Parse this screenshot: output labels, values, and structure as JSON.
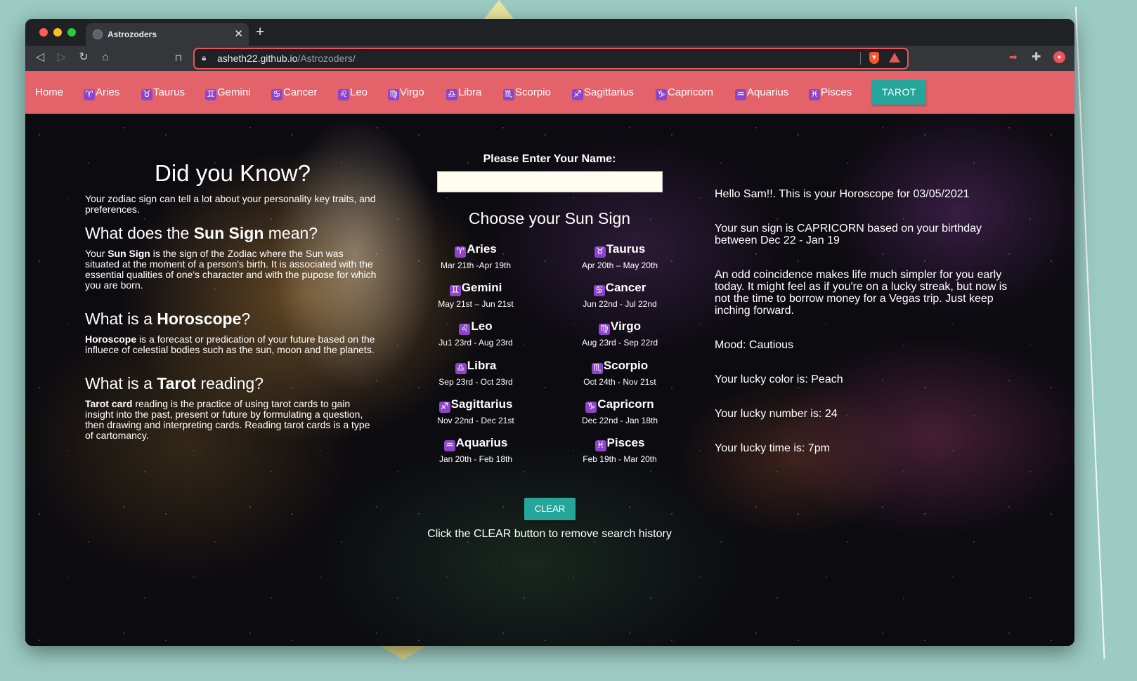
{
  "browser": {
    "tab_title": "Astrozoders",
    "url_host": "asheth22.github.io",
    "url_path": "/Astrozoders/"
  },
  "nav": {
    "home": "Home",
    "items": [
      {
        "symbol": "♈",
        "label": "Aries"
      },
      {
        "symbol": "♉",
        "label": "Taurus"
      },
      {
        "symbol": "♊",
        "label": "Gemini"
      },
      {
        "symbol": "♋",
        "label": "Cancer"
      },
      {
        "symbol": "♌",
        "label": "Leo"
      },
      {
        "symbol": "♍",
        "label": "Virgo"
      },
      {
        "symbol": "♎",
        "label": "Libra"
      },
      {
        "symbol": "♏",
        "label": "Scorpio"
      },
      {
        "symbol": "♐",
        "label": "Sagittarius"
      },
      {
        "symbol": "♑",
        "label": "Capricorn"
      },
      {
        "symbol": "♒",
        "label": "Aquarius"
      },
      {
        "symbol": "♓",
        "label": "Pisces"
      }
    ],
    "tarot": "TAROT"
  },
  "left": {
    "title": "Did you Know?",
    "intro": "Your zodiac sign can tell a lot about your personality key traits, and preferences.",
    "sun_q": {
      "pre": "What does the ",
      "bold": "Sun Sign",
      "post": " mean?"
    },
    "sun_p": {
      "pre": "Your ",
      "bold": "Sun Sign",
      "post": " is the sign of the Zodiac where the Sun was situated at the moment of a person's birth. It is associated with the essential qualities of one's character and with the pupose for which you are born."
    },
    "horo_q": {
      "pre": "What is a ",
      "bold": "Horoscope",
      "post": "?"
    },
    "horo_p": {
      "bold": "Horoscope",
      "post": " is a forecast or predication of your future based on the influece of celestial bodies such as the sun, moon and the planets."
    },
    "tarot_q": {
      "pre": "What is a ",
      "bold": "Tarot",
      "post": " reading?"
    },
    "tarot_p": {
      "bold": "Tarot card",
      "post": " reading is the practice of using tarot cards to gain insight into the past, present or future by formulating a question, then drawing and interpreting cards. Reading tarot cards is a type of cartomancy."
    }
  },
  "center": {
    "name_label": "Please Enter Your Name:",
    "name_value": "",
    "choose_title": "Choose your Sun Sign",
    "signs": [
      {
        "symbol": "♈",
        "name": "Aries",
        "dates": "Mar 21th -Apr 19th"
      },
      {
        "symbol": "♉",
        "name": "Taurus",
        "dates": "Apr 20th – May 20th"
      },
      {
        "symbol": "♊",
        "name": "Gemini",
        "dates": "May 21st – Jun 21st"
      },
      {
        "symbol": "♋",
        "name": "Cancer",
        "dates": "Jun 22nd - Jul 22nd"
      },
      {
        "symbol": "♌",
        "name": "Leo",
        "dates": "Ju1 23rd - Aug 23rd"
      },
      {
        "symbol": "♍",
        "name": "Virgo",
        "dates": "Aug 23rd - Sep 22rd"
      },
      {
        "symbol": "♎",
        "name": "Libra",
        "dates": "Sep 23rd - Oct 23rd"
      },
      {
        "symbol": "♏",
        "name": "Scorpio",
        "dates": "Oct 24th - Nov 21st"
      },
      {
        "symbol": "♐",
        "name": "Sagittarius",
        "dates": "Nov 22nd - Dec 21st"
      },
      {
        "symbol": "♑",
        "name": "Capricorn",
        "dates": "Dec 22nd - Jan 18th"
      },
      {
        "symbol": "♒",
        "name": "Aquarius",
        "dates": "Jan 20th - Feb 18th"
      },
      {
        "symbol": "♓",
        "name": "Pisces",
        "dates": "Feb 19th - Mar 20th"
      }
    ],
    "clear_label": "CLEAR",
    "clear_note": "Click the CLEAR button to remove search history"
  },
  "right": {
    "greeting": "Hello Sam!!. This is your Horoscope for 03/05/2021",
    "sign_info": "Your sun sign is CAPRICORN based on your birthday between Dec 22 - Jan 19",
    "reading": "An odd coincidence makes life much simpler for you early today. It might feel as if you're on a lucky streak, but now is not the time to borrow money for a Vegas trip. Just keep inching forward.",
    "mood": "Mood: Cautious",
    "lucky_color": "Your lucky color is: Peach",
    "lucky_number": "Your lucky number is: 24",
    "lucky_time": "Your lucky time is: 7pm"
  },
  "colors": {
    "nav_bg": "#e4636b",
    "accent": "#26a69a",
    "zodiac_badge": "#8e44c9",
    "desktop_bg": "#9ccbc3"
  },
  "icons": [
    "back-icon",
    "forward-icon",
    "reload-icon",
    "home-icon",
    "bookmark-icon",
    "lock-icon",
    "brave-shield-icon",
    "brave-rewards-icon",
    "extension-icon",
    "puzzle-icon",
    "profile-icon"
  ]
}
